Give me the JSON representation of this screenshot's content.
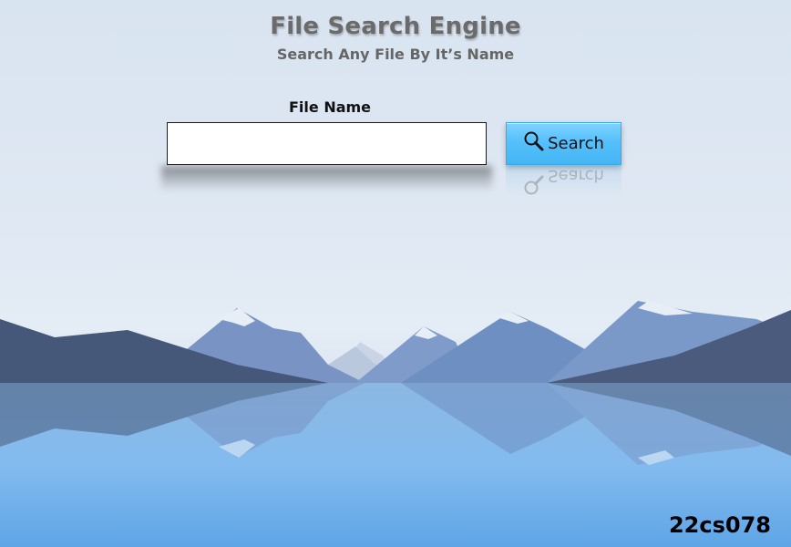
{
  "header": {
    "title": "File Search Engine",
    "subtitle": "Search Any File By It’s Name"
  },
  "search": {
    "label": "File Name",
    "value": "",
    "placeholder": "",
    "button_label": "Search",
    "button_icon": "search-icon"
  },
  "footer": {
    "id_text": "22cs078"
  },
  "colors": {
    "button": "#55c0fb",
    "title": "#6b6b6b",
    "mountain_dark": "#46587a",
    "mountain_mid": "#6d8fc4",
    "water": "#7fb6ea"
  }
}
